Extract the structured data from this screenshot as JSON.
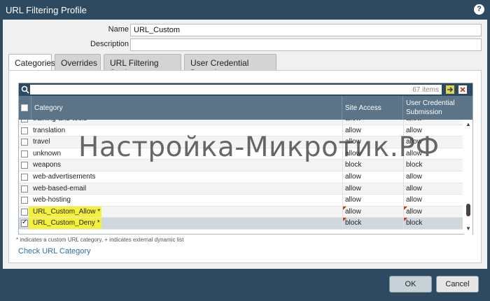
{
  "window": {
    "title": "URL Filtering Profile",
    "help_label": "?"
  },
  "form": {
    "name_label": "Name",
    "name_value": "URL_Custom",
    "description_label": "Description",
    "description_value": ""
  },
  "tabs": [
    {
      "label": "Categories",
      "active": true
    },
    {
      "label": "Overrides",
      "active": false
    },
    {
      "label": "URL Filtering Settings",
      "active": false
    },
    {
      "label": "User Credential Detection",
      "active": false
    }
  ],
  "grid": {
    "search_value": "67 items",
    "columns": {
      "category": "Category",
      "site_access": "Site Access",
      "user_credential_line1": "User Credential",
      "user_credential_line2": "Submission"
    },
    "rows": [
      {
        "category": "training-and-tools",
        "site": "allow",
        "user": "allow",
        "checked": false,
        "partial": true
      },
      {
        "category": "translation",
        "site": "allow",
        "user": "allow",
        "checked": false
      },
      {
        "category": "travel",
        "site": "allow",
        "user": "allow",
        "checked": false
      },
      {
        "category": "unknown",
        "site": "allow",
        "user": "allow",
        "checked": false
      },
      {
        "category": "weapons",
        "site": "block",
        "user": "block",
        "checked": false
      },
      {
        "category": "web-advertisements",
        "site": "allow",
        "user": "allow",
        "checked": false
      },
      {
        "category": "web-based-email",
        "site": "allow",
        "user": "allow",
        "checked": false
      },
      {
        "category": "web-hosting",
        "site": "allow",
        "user": "allow",
        "checked": false
      },
      {
        "category": "URL_Custom_Allow *",
        "site": "allow",
        "user": "allow",
        "checked": false,
        "custom": true
      },
      {
        "category": "URL_Custom_Deny *",
        "site": "block",
        "user": "block",
        "checked": true,
        "custom": true,
        "selected": true
      }
    ]
  },
  "note": "* indicates a custom URL category, + indicates external dynamic list",
  "check_link": "Check URL Category",
  "watermark": "Настройка-Микротик.РФ",
  "buttons": {
    "ok": "OK",
    "cancel": "Cancel"
  },
  "colors": {
    "titlebar": "#2d4a60",
    "header": "#5b7487",
    "highlight": "#f5f13a",
    "link": "#2d6fa3"
  }
}
